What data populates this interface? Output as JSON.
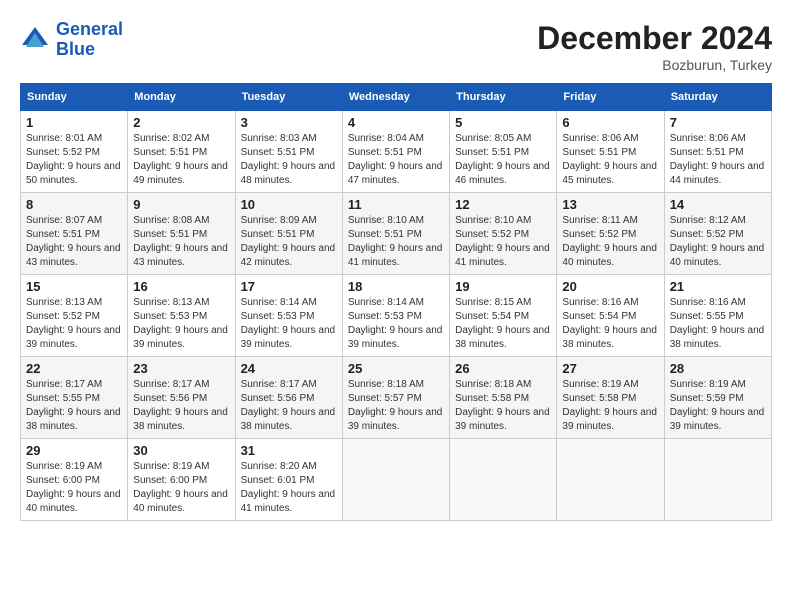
{
  "logo": {
    "line1": "General",
    "line2": "Blue"
  },
  "title": "December 2024",
  "location": "Bozburun, Turkey",
  "headers": [
    "Sunday",
    "Monday",
    "Tuesday",
    "Wednesday",
    "Thursday",
    "Friday",
    "Saturday"
  ],
  "weeks": [
    [
      {
        "day": "1",
        "sunrise": "Sunrise: 8:01 AM",
        "sunset": "Sunset: 5:52 PM",
        "daylight": "Daylight: 9 hours and 50 minutes."
      },
      {
        "day": "2",
        "sunrise": "Sunrise: 8:02 AM",
        "sunset": "Sunset: 5:51 PM",
        "daylight": "Daylight: 9 hours and 49 minutes."
      },
      {
        "day": "3",
        "sunrise": "Sunrise: 8:03 AM",
        "sunset": "Sunset: 5:51 PM",
        "daylight": "Daylight: 9 hours and 48 minutes."
      },
      {
        "day": "4",
        "sunrise": "Sunrise: 8:04 AM",
        "sunset": "Sunset: 5:51 PM",
        "daylight": "Daylight: 9 hours and 47 minutes."
      },
      {
        "day": "5",
        "sunrise": "Sunrise: 8:05 AM",
        "sunset": "Sunset: 5:51 PM",
        "daylight": "Daylight: 9 hours and 46 minutes."
      },
      {
        "day": "6",
        "sunrise": "Sunrise: 8:06 AM",
        "sunset": "Sunset: 5:51 PM",
        "daylight": "Daylight: 9 hours and 45 minutes."
      },
      {
        "day": "7",
        "sunrise": "Sunrise: 8:06 AM",
        "sunset": "Sunset: 5:51 PM",
        "daylight": "Daylight: 9 hours and 44 minutes."
      }
    ],
    [
      {
        "day": "8",
        "sunrise": "Sunrise: 8:07 AM",
        "sunset": "Sunset: 5:51 PM",
        "daylight": "Daylight: 9 hours and 43 minutes."
      },
      {
        "day": "9",
        "sunrise": "Sunrise: 8:08 AM",
        "sunset": "Sunset: 5:51 PM",
        "daylight": "Daylight: 9 hours and 43 minutes."
      },
      {
        "day": "10",
        "sunrise": "Sunrise: 8:09 AM",
        "sunset": "Sunset: 5:51 PM",
        "daylight": "Daylight: 9 hours and 42 minutes."
      },
      {
        "day": "11",
        "sunrise": "Sunrise: 8:10 AM",
        "sunset": "Sunset: 5:51 PM",
        "daylight": "Daylight: 9 hours and 41 minutes."
      },
      {
        "day": "12",
        "sunrise": "Sunrise: 8:10 AM",
        "sunset": "Sunset: 5:52 PM",
        "daylight": "Daylight: 9 hours and 41 minutes."
      },
      {
        "day": "13",
        "sunrise": "Sunrise: 8:11 AM",
        "sunset": "Sunset: 5:52 PM",
        "daylight": "Daylight: 9 hours and 40 minutes."
      },
      {
        "day": "14",
        "sunrise": "Sunrise: 8:12 AM",
        "sunset": "Sunset: 5:52 PM",
        "daylight": "Daylight: 9 hours and 40 minutes."
      }
    ],
    [
      {
        "day": "15",
        "sunrise": "Sunrise: 8:13 AM",
        "sunset": "Sunset: 5:52 PM",
        "daylight": "Daylight: 9 hours and 39 minutes."
      },
      {
        "day": "16",
        "sunrise": "Sunrise: 8:13 AM",
        "sunset": "Sunset: 5:53 PM",
        "daylight": "Daylight: 9 hours and 39 minutes."
      },
      {
        "day": "17",
        "sunrise": "Sunrise: 8:14 AM",
        "sunset": "Sunset: 5:53 PM",
        "daylight": "Daylight: 9 hours and 39 minutes."
      },
      {
        "day": "18",
        "sunrise": "Sunrise: 8:14 AM",
        "sunset": "Sunset: 5:53 PM",
        "daylight": "Daylight: 9 hours and 39 minutes."
      },
      {
        "day": "19",
        "sunrise": "Sunrise: 8:15 AM",
        "sunset": "Sunset: 5:54 PM",
        "daylight": "Daylight: 9 hours and 38 minutes."
      },
      {
        "day": "20",
        "sunrise": "Sunrise: 8:16 AM",
        "sunset": "Sunset: 5:54 PM",
        "daylight": "Daylight: 9 hours and 38 minutes."
      },
      {
        "day": "21",
        "sunrise": "Sunrise: 8:16 AM",
        "sunset": "Sunset: 5:55 PM",
        "daylight": "Daylight: 9 hours and 38 minutes."
      }
    ],
    [
      {
        "day": "22",
        "sunrise": "Sunrise: 8:17 AM",
        "sunset": "Sunset: 5:55 PM",
        "daylight": "Daylight: 9 hours and 38 minutes."
      },
      {
        "day": "23",
        "sunrise": "Sunrise: 8:17 AM",
        "sunset": "Sunset: 5:56 PM",
        "daylight": "Daylight: 9 hours and 38 minutes."
      },
      {
        "day": "24",
        "sunrise": "Sunrise: 8:17 AM",
        "sunset": "Sunset: 5:56 PM",
        "daylight": "Daylight: 9 hours and 38 minutes."
      },
      {
        "day": "25",
        "sunrise": "Sunrise: 8:18 AM",
        "sunset": "Sunset: 5:57 PM",
        "daylight": "Daylight: 9 hours and 39 minutes."
      },
      {
        "day": "26",
        "sunrise": "Sunrise: 8:18 AM",
        "sunset": "Sunset: 5:58 PM",
        "daylight": "Daylight: 9 hours and 39 minutes."
      },
      {
        "day": "27",
        "sunrise": "Sunrise: 8:19 AM",
        "sunset": "Sunset: 5:58 PM",
        "daylight": "Daylight: 9 hours and 39 minutes."
      },
      {
        "day": "28",
        "sunrise": "Sunrise: 8:19 AM",
        "sunset": "Sunset: 5:59 PM",
        "daylight": "Daylight: 9 hours and 39 minutes."
      }
    ],
    [
      {
        "day": "29",
        "sunrise": "Sunrise: 8:19 AM",
        "sunset": "Sunset: 6:00 PM",
        "daylight": "Daylight: 9 hours and 40 minutes."
      },
      {
        "day": "30",
        "sunrise": "Sunrise: 8:19 AM",
        "sunset": "Sunset: 6:00 PM",
        "daylight": "Daylight: 9 hours and 40 minutes."
      },
      {
        "day": "31",
        "sunrise": "Sunrise: 8:20 AM",
        "sunset": "Sunset: 6:01 PM",
        "daylight": "Daylight: 9 hours and 41 minutes."
      },
      null,
      null,
      null,
      null
    ]
  ]
}
